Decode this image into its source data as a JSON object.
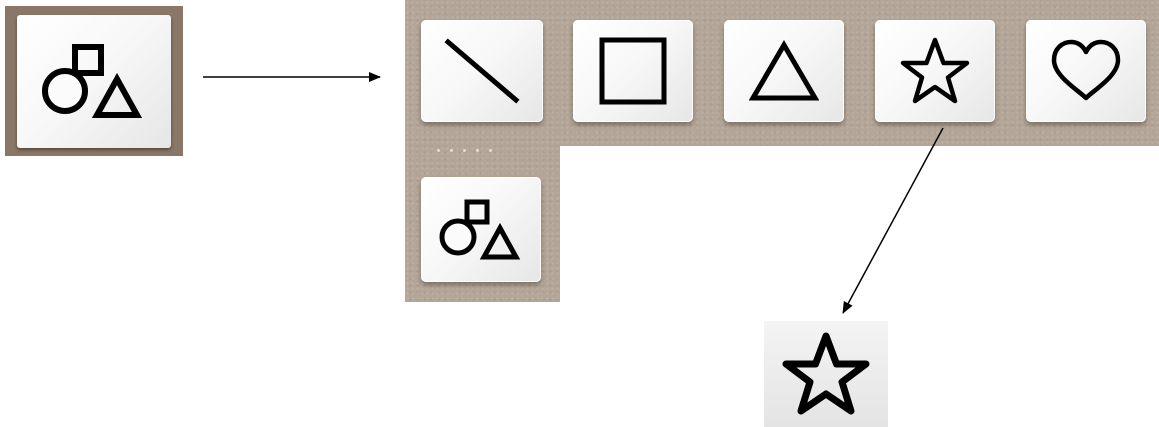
{
  "left_button": {
    "icon": "shapes-icon",
    "frame_color": "#8a7767"
  },
  "toolbar": {
    "background_color": "#b3a698",
    "buttons": [
      {
        "icon": "line-icon"
      },
      {
        "icon": "square-icon"
      },
      {
        "icon": "triangle-icon"
      },
      {
        "icon": "star-icon"
      },
      {
        "icon": "heart-icon"
      }
    ],
    "expanded_button": {
      "icon": "shapes-icon"
    }
  },
  "result": {
    "icon": "star-icon"
  }
}
